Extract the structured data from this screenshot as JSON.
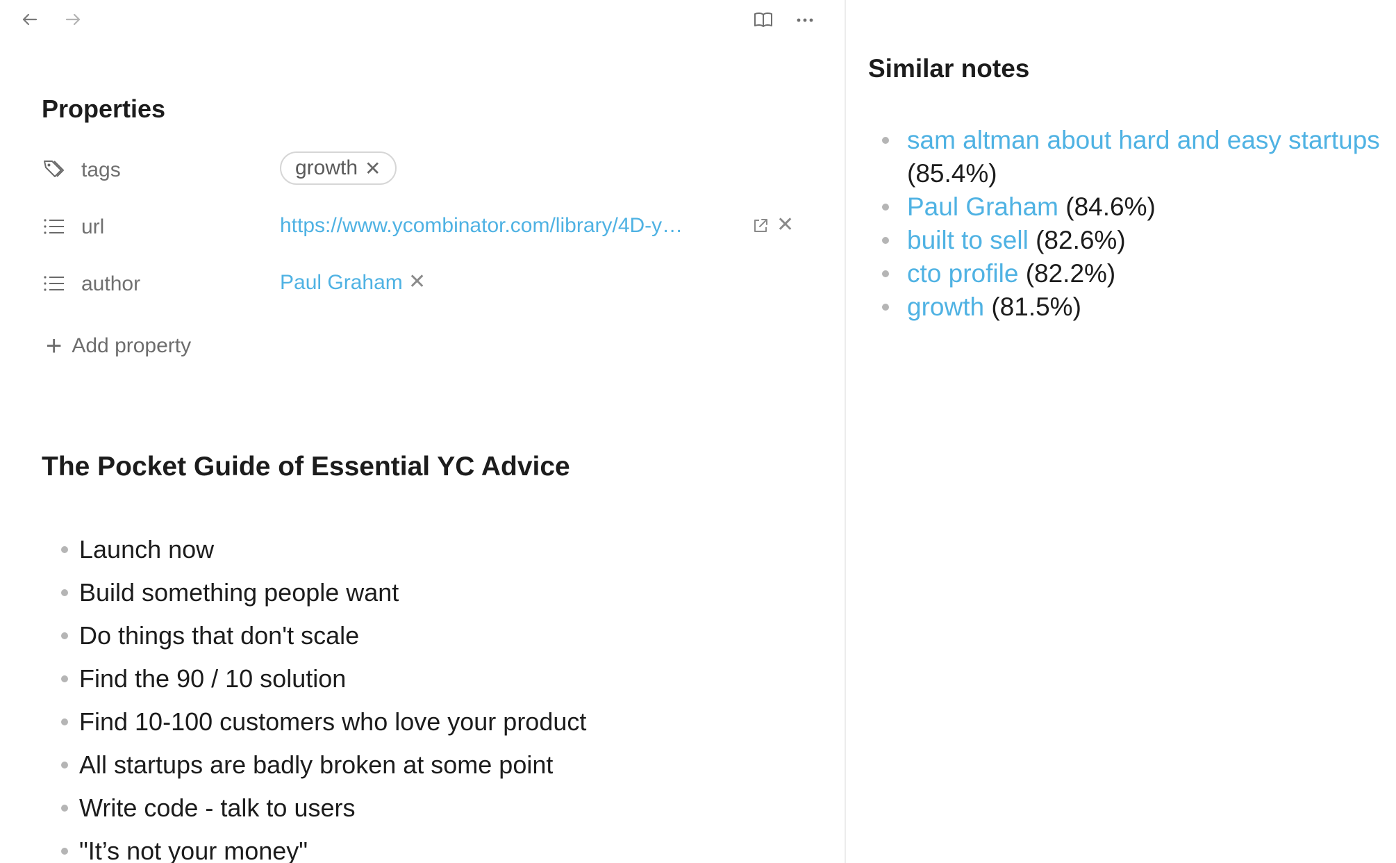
{
  "toolbar": {
    "back_icon": "arrow-left-icon",
    "forward_icon": "arrow-right-icon",
    "reading_icon": "open-book-icon",
    "more_icon": "more-options-icon"
  },
  "properties": {
    "title": "Properties",
    "rows": [
      {
        "icon": "tag-icon",
        "name": "tags",
        "value": "growth",
        "kind": "tag"
      },
      {
        "icon": "list-icon",
        "name": "url",
        "value": "https://www.ycombinator.com/library/4D-y…",
        "kind": "link"
      },
      {
        "icon": "list-icon",
        "name": "author",
        "value": "Paul Graham",
        "kind": "link"
      }
    ],
    "remove_symbol": "✕",
    "add_label": "Add property",
    "add_symbol": "+"
  },
  "document": {
    "title": "The Pocket Guide of Essential YC Advice",
    "items": [
      "Launch now",
      "Build something people want",
      "Do things that don't scale",
      "Find the 90 / 10 solution",
      "Find 10-100 customers who love your product",
      "All startups are badly broken at some point",
      "Write code - talk to users",
      "\"It’s not your money\""
    ]
  },
  "similar_notes": {
    "title": "Similar notes",
    "items": [
      {
        "title": "sam altman about hard and easy startups",
        "score": "(85.4%)"
      },
      {
        "title": "Paul Graham",
        "score": "(84.6%)"
      },
      {
        "title": "built to sell",
        "score": "(82.6%)"
      },
      {
        "title": "cto profile",
        "score": "(82.2%)"
      },
      {
        "title": "growth",
        "score": "(81.5%)"
      }
    ]
  },
  "colors": {
    "link": "#4fb2e3",
    "muted": "#707070",
    "divider": "#ececec"
  }
}
